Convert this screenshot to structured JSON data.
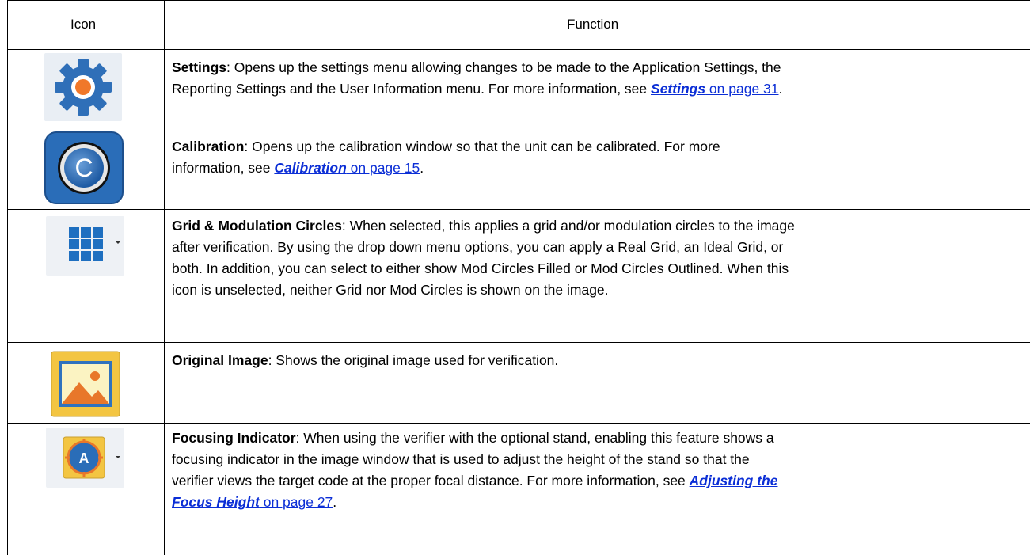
{
  "table": {
    "headers": {
      "icon": "Icon",
      "function": "Function"
    },
    "rows": [
      {
        "icon": "gear-icon",
        "name": "Settings",
        "text_before": ": Opens up the settings menu allowing changes to be made to the Application Settings, the",
        "text_line2": "Reporting Settings and the User Information menu. For more information, see ",
        "link_italic": "Settings",
        "link_rest": " on page 31",
        "text_after": "."
      },
      {
        "icon": "calibration-icon",
        "name": "Calibration",
        "text_before": ": Opens up the calibration window so that the unit can be calibrated. For more",
        "text_line2": "information, see ",
        "link_italic": "Calibration",
        "link_rest": " on page 15",
        "text_after": "."
      },
      {
        "icon": "grid-icon",
        "name": "Grid & Modulation Circles",
        "text_before": ": When selected, this applies a grid and/or modulation circles to the image",
        "lines": [
          "after verification. By using the drop down menu options, you can apply a Real Grid, an Ideal Grid, or",
          "both. In addition, you can select to either show Mod Circles Filled or Mod Circles Outlined. When this",
          "icon is unselected, neither Grid nor Mod Circles is shown on the image."
        ]
      },
      {
        "icon": "image-icon",
        "name": "Original Image",
        "text_before": ": Shows the original image used for verification."
      },
      {
        "icon": "focus-target-icon",
        "name": "Focusing Indicator",
        "text_before": ": When using the verifier with the optional stand, enabling this feature shows a",
        "lines": [
          "focusing indicator in the image window that is used to adjust the height of the stand so that the",
          "verifier views the target code at the proper focal distance. For more information, see "
        ],
        "link_italic_a": "Adjusting the",
        "link_italic_b": "Focus Height",
        "link_rest": " on page 27",
        "text_after": "."
      }
    ]
  },
  "colors": {
    "link": "#0b2ed6",
    "gear_blue": "#2f6fb8",
    "gear_orange": "#f0782a",
    "calib_blue": "#2a6db8",
    "grid_blue": "#1e6fc0",
    "image_frame": "#f3c542",
    "image_orange": "#e8772a"
  }
}
